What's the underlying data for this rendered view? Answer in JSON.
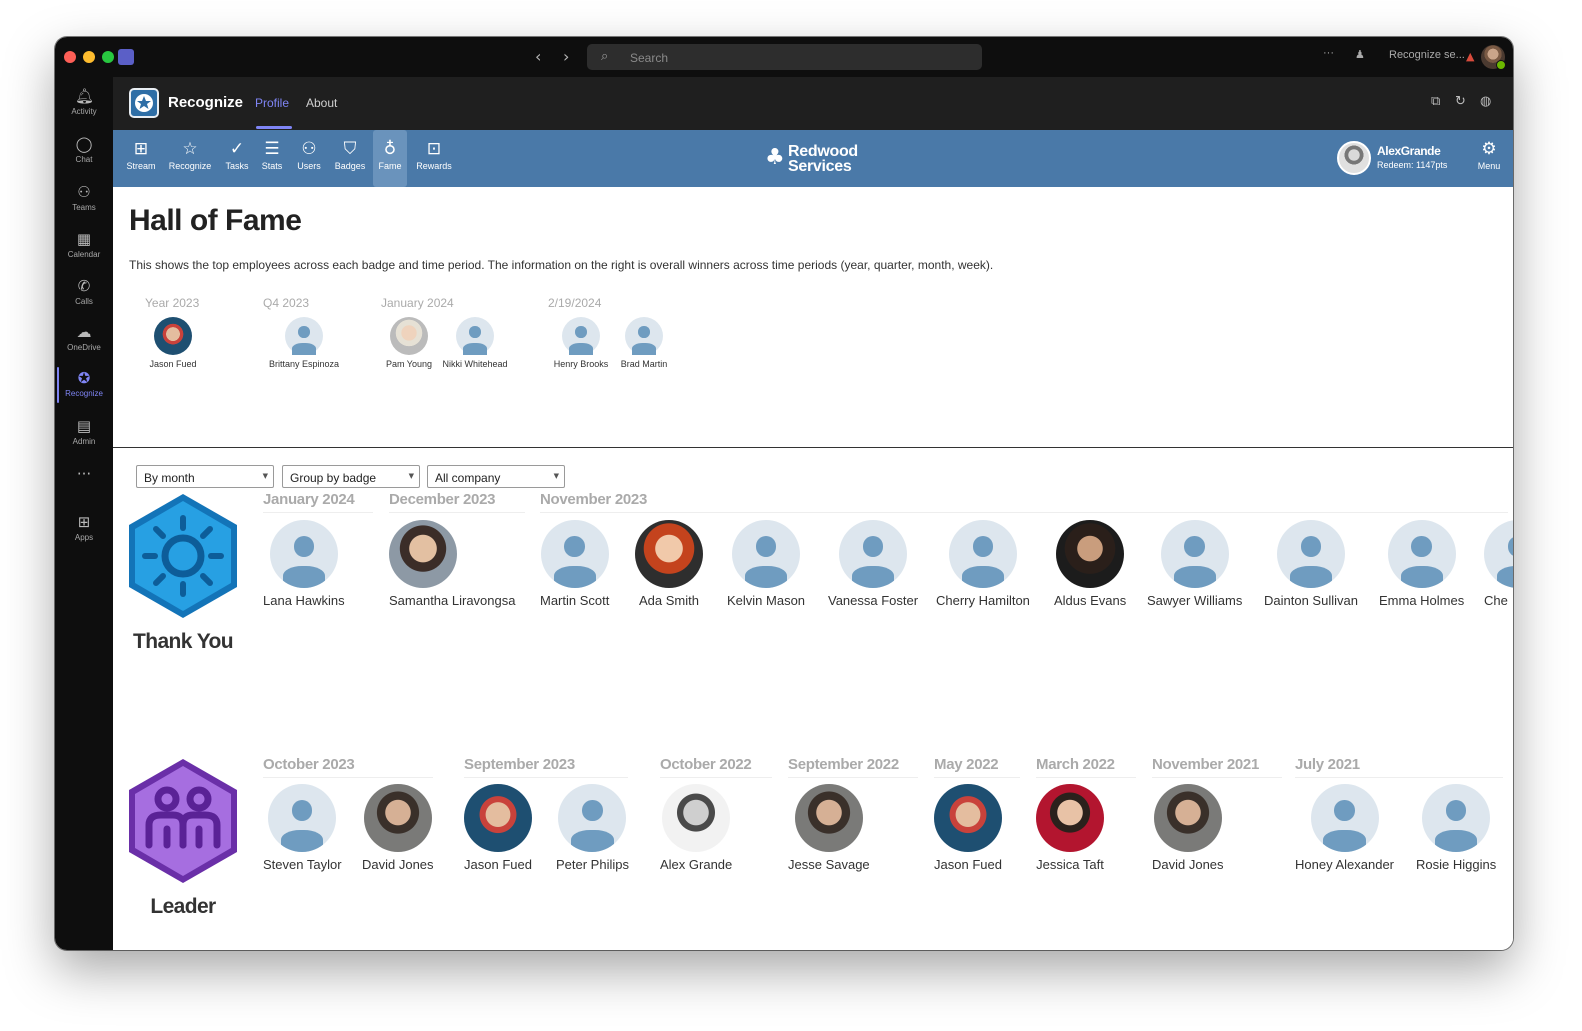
{
  "titlebar": {
    "search_placeholder": "Search",
    "more": "···",
    "account_label": "Recognize se...",
    "back_icon": "chevron-left-icon",
    "forward_icon": "chevron-right-icon"
  },
  "rail": {
    "items": [
      {
        "label": "Activity",
        "icon": "bell-icon"
      },
      {
        "label": "Chat",
        "icon": "chat-icon"
      },
      {
        "label": "Teams",
        "icon": "teams-icon"
      },
      {
        "label": "Calendar",
        "icon": "calendar-icon"
      },
      {
        "label": "Calls",
        "icon": "phone-icon"
      },
      {
        "label": "OneDrive",
        "icon": "cloud-icon"
      },
      {
        "label": "Recognize",
        "icon": "recognize-icon",
        "active": true
      },
      {
        "label": "Admin",
        "icon": "admin-icon"
      },
      {
        "label": "Apps",
        "icon": "apps-icon"
      }
    ],
    "more": "···"
  },
  "app": {
    "name": "Recognize",
    "tabs": [
      {
        "label": "Profile",
        "active": true
      },
      {
        "label": "About"
      }
    ]
  },
  "nav": {
    "items": [
      {
        "label": "Stream",
        "icon": "grid-icon"
      },
      {
        "label": "Recognize",
        "icon": "star-icon"
      },
      {
        "label": "Tasks",
        "icon": "check-circle-icon"
      },
      {
        "label": "Stats",
        "icon": "list-icon"
      },
      {
        "label": "Users",
        "icon": "users-icon"
      },
      {
        "label": "Badges",
        "icon": "shield-icon"
      },
      {
        "label": "Fame",
        "icon": "award-icon",
        "active": true
      },
      {
        "label": "Rewards",
        "icon": "gift-icon"
      }
    ],
    "brand_line1": "Redwood",
    "brand_line2": "Services",
    "user_name": "AlexGrande",
    "user_points": "Redeem: 1147pts",
    "menu_label": "Menu"
  },
  "page": {
    "title": "Hall of Fame",
    "description": "This shows the top employees across each badge and time period. The information on the right is overall winners across time periods (year, quarter, month, week).",
    "winners": [
      {
        "period": "Year 2023",
        "people": [
          "Jason Fued"
        ]
      },
      {
        "period": "Q4 2023",
        "people": [
          "Brittany Espinoza"
        ]
      },
      {
        "period": "January 2024",
        "people": [
          "Pam Young",
          "Nikki Whitehead"
        ]
      },
      {
        "period": "2/19/2024",
        "people": [
          "Henry Brooks",
          "Brad Martin"
        ]
      }
    ]
  },
  "filters": {
    "period": "By month",
    "group": "Group by badge",
    "scope": "All company"
  },
  "badges": [
    {
      "name": "Thank You",
      "color": "#1a86c8",
      "periods": [
        "January 2024",
        "December 2023",
        "November 2023"
      ],
      "people": [
        "Lana Hawkins",
        "Samantha Liravongsa",
        "Martin Scott",
        "Ada Smith",
        "Kelvin Mason",
        "Vanessa Foster",
        "Cherry Hamilton",
        "Aldus Evans",
        "Sawyer Williams",
        "Dainton Sullivan",
        "Emma Holmes",
        "Che"
      ]
    },
    {
      "name": "Leader",
      "color": "#8a4ec6",
      "periods": [
        "October 2023",
        "September 2023",
        "October 2022",
        "September 2022",
        "May 2022",
        "March 2022",
        "November 2021",
        "July 2021"
      ],
      "people": [
        "Steven Taylor",
        "David Jones",
        "Jason Fued",
        "Peter Philips",
        "Alex Grande",
        "Jesse Savage",
        "Jason Fued",
        "Jessica Taft",
        "David Jones",
        "Honey Alexander",
        "Rosie Higgins"
      ]
    }
  ]
}
